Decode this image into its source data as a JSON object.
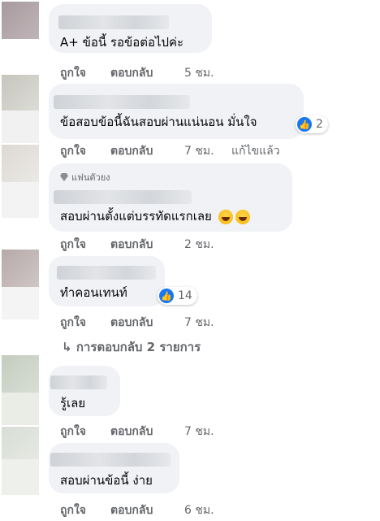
{
  "comments": [
    {
      "text": "A+ ข้อนี้ รอข้อต่อไปค่ะ",
      "like": "ถูกใจ",
      "reply": "ตอบกลับ",
      "time": "5 ชม."
    },
    {
      "text": "ข้อสอบข้อนี้ฉันสอบผ่านแน่นอน มั่นใจ",
      "like": "ถูกใจ",
      "reply": "ตอบกลับ",
      "time": "7 ชม.",
      "edited": "แก้ไขแล้ว",
      "reaction_count": "2",
      "reaction_icon": "like-icon"
    },
    {
      "badge": "แฟนตัวยง",
      "text": "สอบผ่านตั้งแต่บรรทัดแรกเลย",
      "like": "ถูกใจ",
      "reply": "ตอบกลับ",
      "time": "2 ชม.",
      "emoji": [
        "laughing-emoji",
        "laughing-emoji"
      ]
    },
    {
      "text": "ทำคอนเทนท์",
      "like": "ถูกใจ",
      "reply": "ตอบกลับ",
      "time": "7 ชม.",
      "reaction_count": "14",
      "reaction_icon": "like-icon",
      "view_replies": "การตอบกลับ 2 รายการ"
    },
    {
      "text": "รู้เลย",
      "like": "ถูกใจ",
      "reply": "ตอบกลับ",
      "time": "7 ชม."
    },
    {
      "text": "สอบผ่านข้อนี้ ง่าย",
      "like": "ถูกใจ",
      "reply": "ตอบกลับ",
      "time": "6 ชม."
    }
  ],
  "colors": {
    "bubble": "#f0f2f5",
    "meta": "#65676b",
    "like_blue": "#1877f2"
  }
}
